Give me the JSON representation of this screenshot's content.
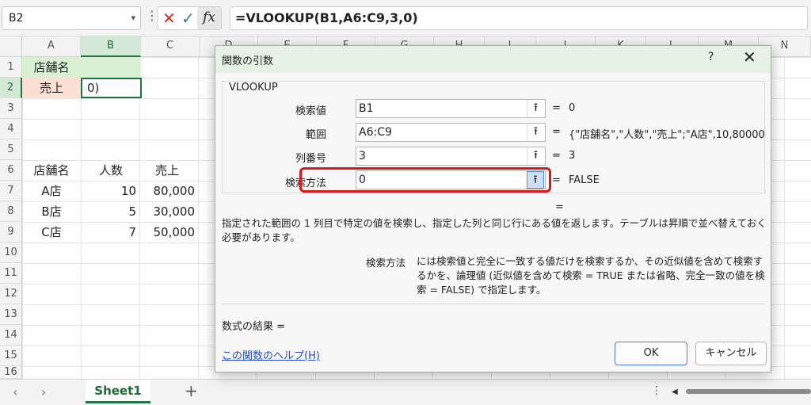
{
  "formula_bar": {
    "name_box": "B2",
    "formula": "=VLOOKUP(B1,A6:C9,3,0)",
    "fx_label": "fx"
  },
  "columns": [
    "A",
    "B",
    "C",
    "D",
    "E",
    "F",
    "G",
    "H",
    "I",
    "J",
    "K",
    "L",
    "M",
    "N"
  ],
  "rows": [
    "1",
    "2",
    "3",
    "4",
    "5",
    "6",
    "7",
    "8",
    "9",
    "10",
    "11",
    "12",
    "13",
    "14",
    "15",
    "16"
  ],
  "cells": {
    "A1": "店舗名",
    "A2": "売上",
    "B2": "0)",
    "A6": "店舗名",
    "B6": "人数",
    "C6": "売上",
    "A7": "A店",
    "B7": "10",
    "C7": "80,000",
    "A8": "B店",
    "B8": "5",
    "C8": "30,000",
    "A9": "C店",
    "B9": "7",
    "C9": "50,000"
  },
  "sheet_tab": "Sheet1",
  "dialog": {
    "title": "関数の引数",
    "help_symbol": "?",
    "close_symbol": "✕",
    "function_name": "VLOOKUP",
    "args": [
      {
        "label": "検索値",
        "value": "B1",
        "result": "0"
      },
      {
        "label": "範囲",
        "value": "A6:C9",
        "result": "{\"店舗名\",\"人数\",\"売上\";\"A店\",10,80000"
      },
      {
        "label": "列番号",
        "value": "3",
        "result": "3"
      },
      {
        "label": "検索方法",
        "value": "0",
        "result": "FALSE"
      }
    ],
    "equals": "=",
    "description": "指定された範囲の 1 列目で特定の値を検索し、指定した列と同じ行にある値を返します。テーブルは昇順で並べ替えておく必要があります。",
    "param_name": "検索方法",
    "param_desc": "には検索値と完全に一致する値だけを検索するか、その近似値を含めて検索するかを、論理値 (近似値を含めて検索 = TRUE または省略、完全一致の値を検索 = FALSE) で指定します。",
    "formula_result": "数式の結果 =",
    "help_link": "この関数のヘルプ(H)",
    "ok": "OK",
    "cancel": "キャンセル"
  }
}
